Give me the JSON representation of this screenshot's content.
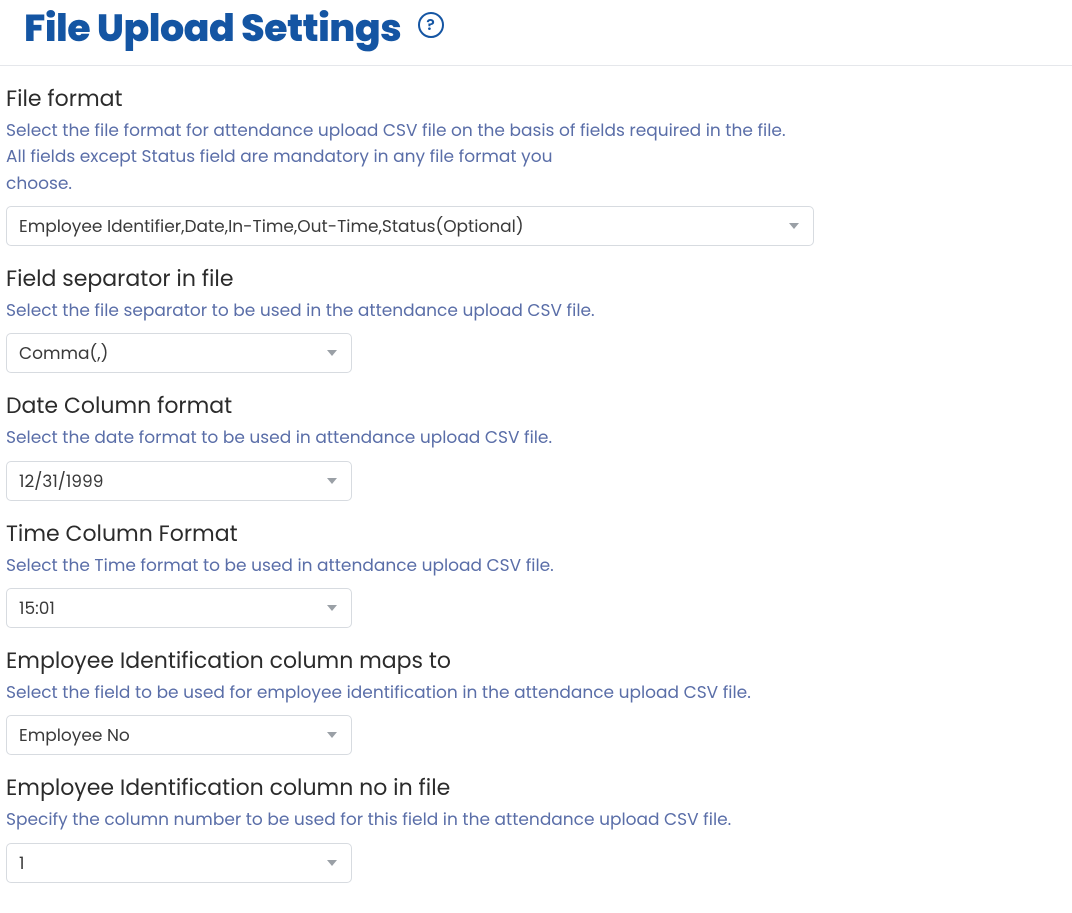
{
  "header": {
    "title": "File Upload Settings",
    "help_tooltip": "?"
  },
  "sections": {
    "file_format": {
      "label": "File format",
      "help_line1": "Select the file format for attendance upload CSV file on the basis of fields required in the file.",
      "help_line2": "All fields except Status field are mandatory in any file format you choose.",
      "value": "Employee Identifier,Date,In-Time,Out-Time,Status(Optional)"
    },
    "field_separator": {
      "label": "Field separator in file",
      "help": "Select the file separator to be used in the attendance upload CSV file.",
      "value": "Comma(,)"
    },
    "date_format": {
      "label": "Date Column format",
      "help": "Select the date format to be used in attendance upload CSV file.",
      "value": "12/31/1999"
    },
    "time_format": {
      "label": "Time Column Format",
      "help": "Select the Time format to be used in attendance upload CSV file.",
      "value": "15:01"
    },
    "emp_id_maps_to": {
      "label": "Employee Identification column maps to",
      "help": "Select the field to be used for employee identification in the attendance upload CSV file.",
      "value": "Employee No"
    },
    "emp_id_col_no": {
      "label": "Employee Identification column no in file",
      "help": "Specify the column number to be used for this field in the attendance upload CSV file.",
      "value": "1"
    }
  }
}
